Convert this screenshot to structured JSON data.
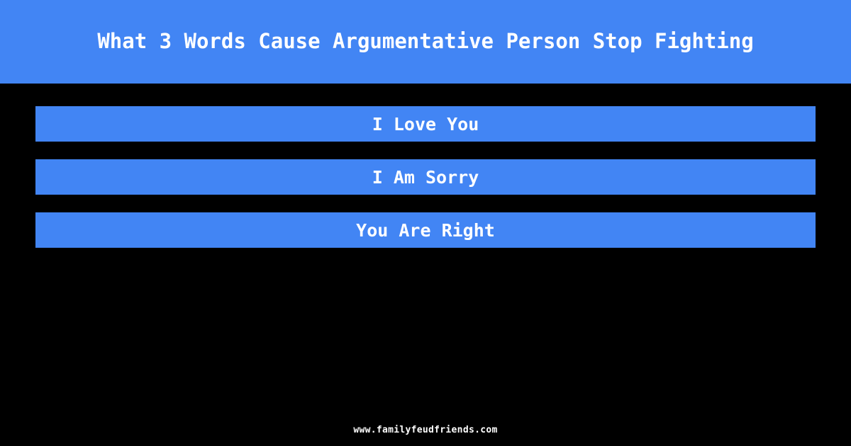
{
  "theme": {
    "accent_color": "#4285f4",
    "background_color": "#000000",
    "text_color": "#ffffff"
  },
  "header": {
    "title": "What 3 Words Cause Argumentative Person Stop Fighting"
  },
  "answers": {
    "items": [
      {
        "label": "I Love You"
      },
      {
        "label": "I Am Sorry"
      },
      {
        "label": "You Are Right"
      }
    ]
  },
  "footer": {
    "site": "www.familyfeudfriends.com"
  }
}
